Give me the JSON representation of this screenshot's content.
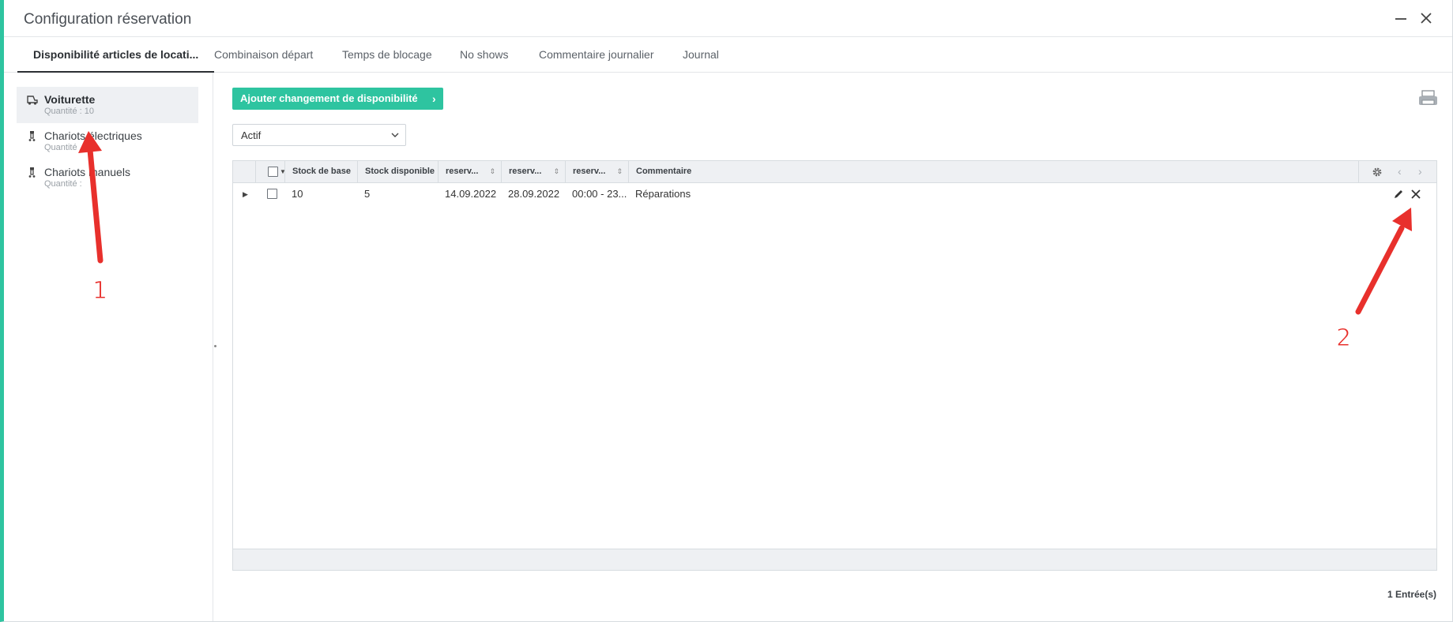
{
  "window": {
    "title": "Configuration réservation",
    "minimize_icon": "minimize-icon",
    "close_icon": "close-icon"
  },
  "tabs": [
    {
      "label": "Disponibilité articles de locati...",
      "active": true
    },
    {
      "label": "Combinaison départ",
      "active": false
    },
    {
      "label": "Temps de blocage",
      "active": false
    },
    {
      "label": "No shows",
      "active": false
    },
    {
      "label": "Commentaire journalier",
      "active": false
    },
    {
      "label": "Journal",
      "active": false
    }
  ],
  "sidebar": {
    "items": [
      {
        "label": "Voiturette",
        "sub": "Quantité : 10",
        "icon": "golf-cart-icon",
        "selected": true
      },
      {
        "label": "Chariots électriques",
        "sub": "Quantité",
        "icon": "trolley-icon",
        "selected": false
      },
      {
        "label": "Chariots manuels",
        "sub": "Quantité :",
        "icon": "trolley-icon",
        "selected": false
      }
    ]
  },
  "toolbar": {
    "add_label": "Ajouter changement de disponibilité",
    "print_icon": "printer-icon"
  },
  "filter": {
    "selected": "Actif"
  },
  "grid": {
    "columns": [
      "Stock de base",
      "Stock disponible",
      "reserv...",
      "reserv...",
      "reserv...",
      "Commentaire"
    ],
    "rows": [
      {
        "stock_base": "10",
        "stock_dispo": "5",
        "start": "14.09.2022",
        "end": "28.09.2022",
        "time": "00:00 - 23...",
        "comment": "Réparations"
      }
    ],
    "settings_icon": "gear-icon",
    "prev_icon": "chevron-left-icon",
    "next_icon": "chevron-right-icon",
    "edit_icon": "pencil-icon",
    "delete_icon": "close-icon"
  },
  "footer": {
    "entries": "1 Entrée(s)"
  },
  "annotations": {
    "marker1": "1",
    "marker2": "2",
    "color": "#e8302c"
  },
  "colors": {
    "accent": "#2ec4a0"
  }
}
